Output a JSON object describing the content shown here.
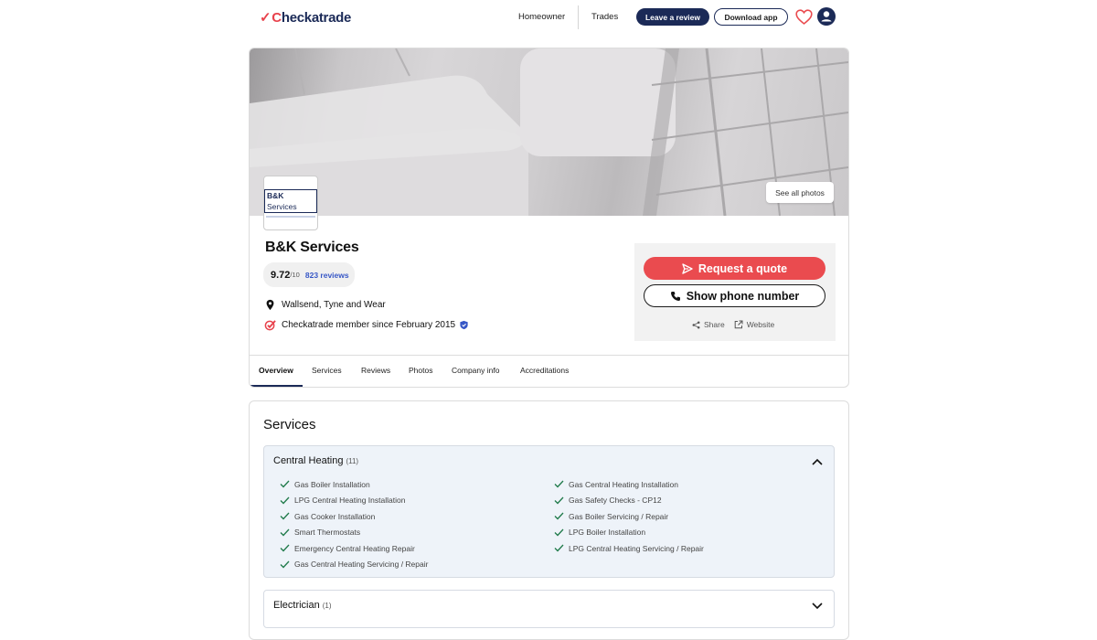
{
  "header": {
    "logo_text": "heckatrade",
    "logo_mark": "✓",
    "nav": [
      "Homeowner",
      "Trades"
    ],
    "leave_review": "Leave a review",
    "download_app": "Download app",
    "icons": [
      "heart-icon",
      "user-icon"
    ],
    "brand_color": "#1b2a57",
    "accent_color": "#ea4b4f"
  },
  "profile": {
    "see_photos": "See all photos",
    "logo_text_bold": "B&K",
    "logo_text_regular": "Services",
    "name": "B&K Services",
    "score": "9.72",
    "score_suffix": "/10",
    "reviews": "823 reviews",
    "location": "Wallsend, Tyne and Wear",
    "member_since": "Checkatrade member since February 2015",
    "request_quote": "Request a quote",
    "show_phone": "Show phone number",
    "share": "Share",
    "website": "Website",
    "tabs": [
      "Overview",
      "Services",
      "Reviews",
      "Photos",
      "Company info",
      "Accreditations"
    ]
  },
  "services": {
    "title": "Services",
    "categories": [
      {
        "name": "Central Heating",
        "count": "(11)",
        "expanded": true,
        "left": [
          "Gas Boiler Installation",
          "LPG Central Heating Installation",
          "Gas Cooker Installation",
          "Smart Thermostats",
          "Emergency Central Heating Repair",
          "Gas Central Heating Servicing / Repair"
        ],
        "right": [
          "Gas Central Heating Installation",
          "Gas Safety Checks - CP12",
          "Gas Boiler Servicing / Repair",
          "LPG Boiler Installation",
          "LPG Central Heating Servicing / Repair"
        ]
      },
      {
        "name": "Electrician",
        "count": "(1)",
        "expanded": false
      }
    ]
  }
}
